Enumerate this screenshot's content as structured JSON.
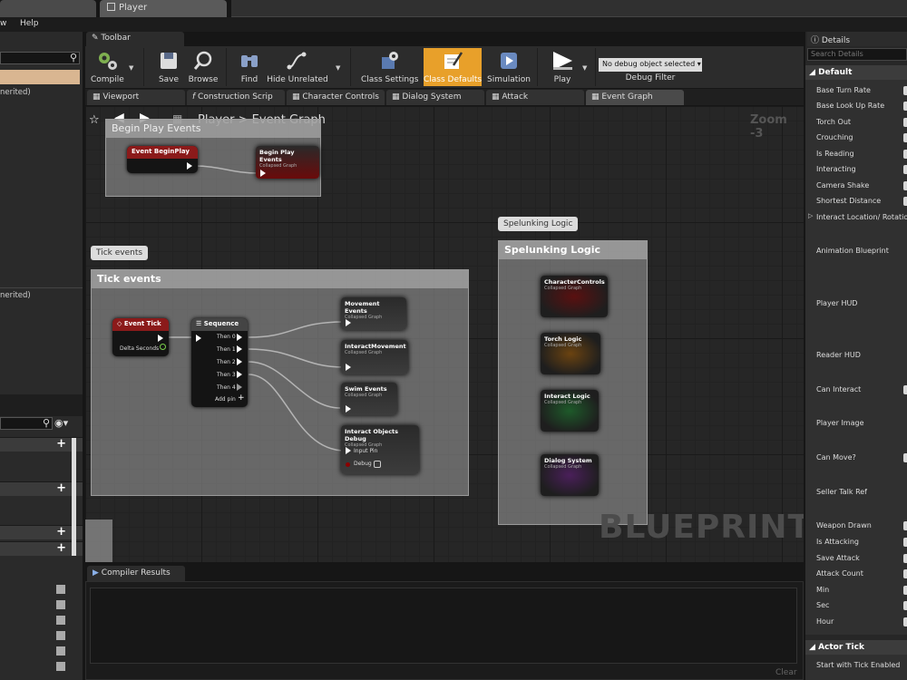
{
  "top_tabs": {
    "player_label": "Player"
  },
  "menu": {
    "view": "w",
    "help": "Help"
  },
  "left_panel": {
    "inherited_1": "nerited)",
    "inherited_2": "nerited)"
  },
  "toolbar": {
    "tab": "Toolbar",
    "buttons": {
      "compile": "Compile",
      "save": "Save",
      "browse": "Browse",
      "find": "Find",
      "hide_unrelated": "Hide Unrelated",
      "class_settings": "Class Settings",
      "class_defaults": "Class Defaults",
      "simulation": "Simulation",
      "play": "Play"
    },
    "debug_select": "No debug object selected",
    "debug_filter": "Debug Filter"
  },
  "doc_tabs": [
    "Viewport",
    "Construction Scrip",
    "Character Controls",
    "Dialog System",
    "Attack",
    "Event Graph"
  ],
  "graph": {
    "breadcrumb": {
      "root": "Player",
      "separator": ">",
      "current": "Event Graph"
    },
    "zoom": "Zoom -3",
    "watermark": "BLUEPRINT",
    "comments": {
      "begin_play": {
        "header": "Begin Play Events"
      },
      "tick": {
        "bubble": "Tick events",
        "header": "Tick events"
      },
      "spelunking": {
        "bubble": "Spelunking Logic",
        "header": "Spelunking Logic"
      }
    },
    "nodes": {
      "event_begin_play": "Event BeginPlay",
      "begin_play_events": {
        "title": "Begin Play Events",
        "sub": "Collapsed Graph"
      },
      "event_tick": {
        "title": "Event Tick",
        "pin": "Delta Seconds"
      },
      "sequence": {
        "title": "Sequence",
        "pins": [
          "Then 0",
          "Then 1",
          "Then 2",
          "Then 3",
          "Then 4"
        ],
        "add_pin": "Add pin"
      },
      "movement_events": {
        "title": "Movement Events",
        "sub": "Collapsed Graph"
      },
      "interact_movement": {
        "title": "InteractMovement",
        "sub": "Collapsed Graph"
      },
      "swim_events": {
        "title": "Swim Events",
        "sub": "Collapsed Graph"
      },
      "interact_objects_debug": {
        "title": "Interact Objects Debug",
        "sub": "Collapsed Graph",
        "pin_input": "Input Pin",
        "pin_debug": "Debug"
      },
      "character_controls": {
        "title": "CharacterControls",
        "sub": "Collapsed Graph",
        "color": "#5a1010"
      },
      "torch_logic": {
        "title": "Torch Logic",
        "sub": "Collapsed Graph",
        "color": "#6b4310"
      },
      "interact_logic": {
        "title": "Interact Logic",
        "sub": "Collapsed Graph",
        "color": "#1e5a2a"
      },
      "dialog_system": {
        "title": "Dialog System",
        "sub": "Collapsed Graph",
        "color": "#4a1f5a"
      }
    }
  },
  "compiler": {
    "tab": "Compiler Results",
    "clear": "Clear"
  },
  "details": {
    "tab": "Details",
    "search_placeholder": "Search Details",
    "default_section": "Default",
    "props": [
      "Base Turn Rate",
      "Base Look Up Rate",
      "Torch Out",
      "Crouching",
      "Is Reading",
      "Interacting",
      "Camera Shake",
      "Shortest Distance",
      "Interact Location/ Rotatio",
      "Animation Blueprint",
      "Player HUD",
      "Reader HUD",
      "Can Interact",
      "Player Image",
      "Can Move?",
      "Seller Talk Ref",
      "Weapon Drawn",
      "Is Attacking",
      "Save Attack",
      "Attack Count",
      "Min",
      "Sec",
      "Hour"
    ],
    "actor_tick_section": "Actor Tick",
    "start_tick": "Start with Tick Enabled"
  },
  "colors": {
    "accent_orange": "#e8a02a",
    "event_red": "#8b1a1a",
    "function_gray": "#3a3a3a"
  }
}
